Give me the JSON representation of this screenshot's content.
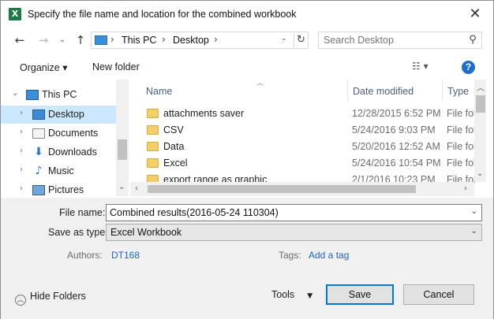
{
  "window": {
    "title": "Specify the file name and location for the combined workbook",
    "app_icon_letter": "X",
    "close_glyph": "✕"
  },
  "nav": {
    "back_glyph": "←",
    "forward_glyph": "→",
    "recent_glyph": "⌄",
    "up_glyph": "↑",
    "breadcrumb": [
      "This PC",
      "Desktop"
    ],
    "crumb_sep": "›",
    "dropdown_glyph": "⌄",
    "refresh_glyph": "↻",
    "search_placeholder": "Search Desktop",
    "search_glyph": "⚲"
  },
  "commands": {
    "organize": "Organize ▾",
    "new_folder": "New folder",
    "view_glyph": "☷ ▾",
    "help_glyph": "?"
  },
  "tree": {
    "items": [
      {
        "label": "This PC",
        "chevron": "⌄",
        "icon": "pc-icon"
      },
      {
        "label": "Desktop",
        "chevron": "›",
        "icon": "desktop-icon",
        "selected": true
      },
      {
        "label": "Documents",
        "chevron": "›",
        "icon": "documents-icon"
      },
      {
        "label": "Downloads",
        "chevron": "›",
        "icon": "downloads-icon"
      },
      {
        "label": "Music",
        "chevron": "›",
        "icon": "music-icon"
      },
      {
        "label": "Pictures",
        "chevron": "›",
        "icon": "pictures-icon"
      }
    ],
    "scroll_down_glyph": "⌄"
  },
  "files": {
    "columns": {
      "name": "Name",
      "date": "Date modified",
      "type": "Type"
    },
    "sort_glyph": "︿",
    "rows": [
      {
        "name": "attachments saver",
        "date": "12/28/2015 6:52 PM",
        "type": "File fol"
      },
      {
        "name": "CSV",
        "date": "5/24/2016 9:03 PM",
        "type": "File fol"
      },
      {
        "name": "Data",
        "date": "5/20/2016 12:52 AM",
        "type": "File fol"
      },
      {
        "name": "Excel",
        "date": "5/24/2016 10:54 PM",
        "type": "File fol"
      },
      {
        "name": "export range as graphic",
        "date": "2/1/2016 10:23 PM",
        "type": "File fol"
      }
    ],
    "scroll_glyphs": {
      "up": "︿",
      "down": "⌄",
      "left": "‹",
      "right": "›"
    }
  },
  "form": {
    "file_name_label": "File name:",
    "file_name_value": "Combined results(2016-05-24 110304)",
    "save_type_label": "Save as type:",
    "save_type_value": "Excel Workbook",
    "drop_glyph": "⌄",
    "authors_label": "Authors:",
    "authors_value": "DT168",
    "tags_label": "Tags:",
    "tags_value": "Add a tag"
  },
  "footer": {
    "hide_folders": "Hide Folders",
    "hide_glyph": "︿",
    "tools": "Tools",
    "tools_caret": "▼",
    "save": "Save",
    "cancel": "Cancel"
  }
}
